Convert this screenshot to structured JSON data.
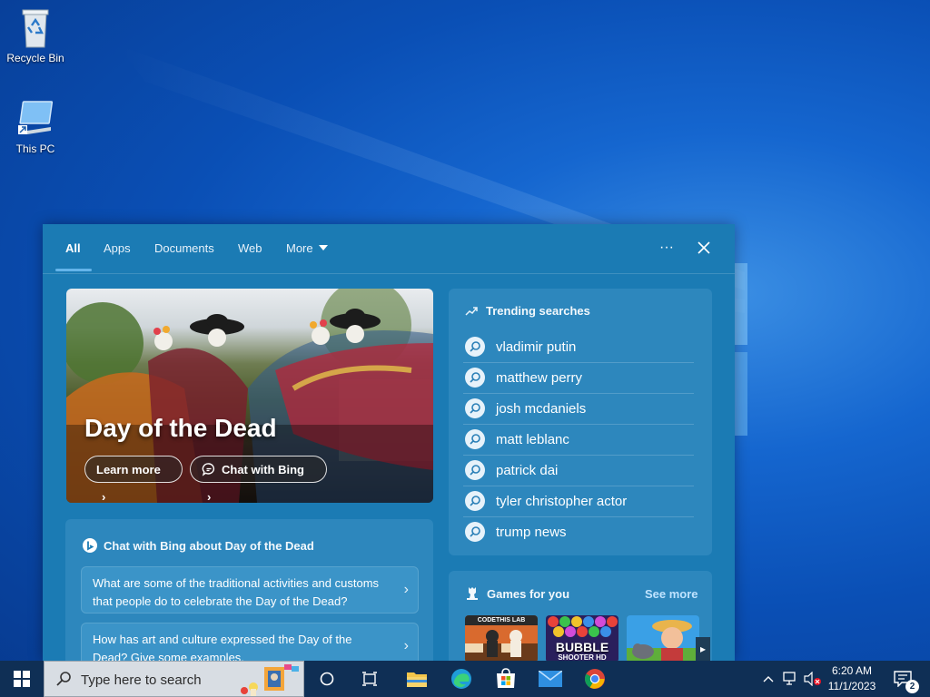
{
  "desktop": {
    "icons": [
      {
        "label": "Recycle Bin",
        "icon": "recycle-bin-icon"
      },
      {
        "label": "This PC",
        "icon": "computer-icon"
      }
    ]
  },
  "search_panel": {
    "tabs": [
      {
        "label": "All",
        "active": true
      },
      {
        "label": "Apps"
      },
      {
        "label": "Documents"
      },
      {
        "label": "Web"
      },
      {
        "label": "More"
      }
    ],
    "more_options_label": "···",
    "close_label": "✕",
    "hero": {
      "title": "Day of the Dead",
      "learn_more": "Learn more",
      "chat_with_bing": "Chat with Bing"
    },
    "chat_card": {
      "title": "Chat with Bing about Day of the Dead",
      "questions": [
        "What are some of the traditional activities and customs that people do to celebrate the Day of the Dead?",
        "How has art and culture expressed the Day of the Dead? Give some examples."
      ]
    },
    "trending": {
      "title": "Trending searches",
      "items": [
        "vladimir putin",
        "matthew perry",
        "josh mcdaniels",
        "matt leblanc",
        "patrick dai",
        "tyler christopher actor",
        "trump news"
      ]
    },
    "games": {
      "title": "Games for you",
      "see_more": "See more",
      "thumb_texts": [
        "CODETHIS LAB",
        "BUBBLE",
        "SHOOTER HD"
      ]
    }
  },
  "taskbar": {
    "search_placeholder": "Type here to search",
    "apps": [
      "cortana-icon",
      "task-view-icon",
      "file-explorer-icon",
      "edge-icon",
      "store-icon",
      "mail-icon",
      "chrome-icon"
    ],
    "clock_time": "6:20 AM",
    "clock_date": "11/1/2023",
    "notification_count": "2"
  },
  "colors": {
    "panel_bg": "#1b7bb4",
    "card_bg": "#2d87bd",
    "taskbar_bg": "#0f2f55",
    "link_color": "#bfe3ff"
  }
}
